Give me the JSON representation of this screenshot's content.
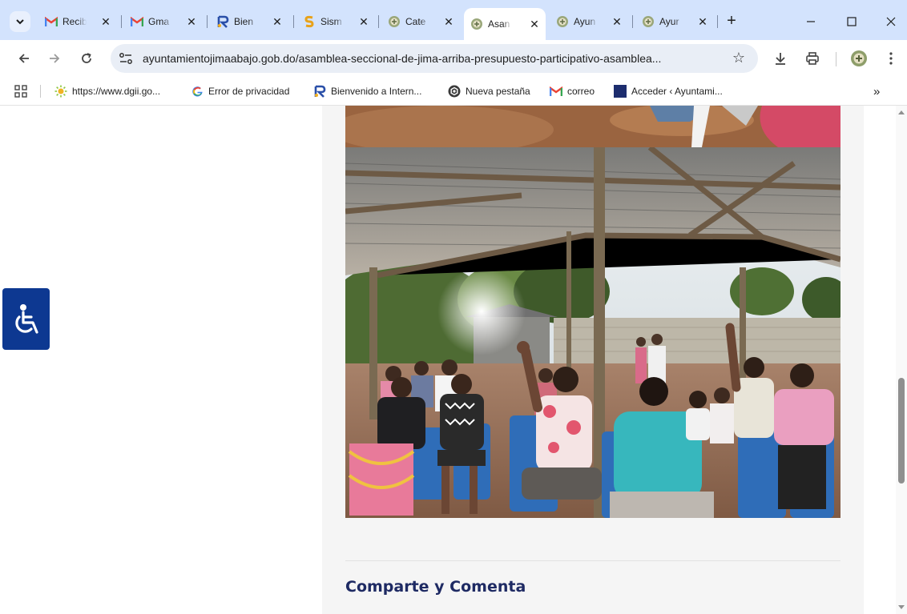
{
  "tabs": [
    {
      "title": "Recib",
      "favicon": "gmail-icon"
    },
    {
      "title": "Gma",
      "favicon": "gmail-icon"
    },
    {
      "title": "Bien",
      "favicon": "dgii-icon"
    },
    {
      "title": "Sism",
      "favicon": "sism-icon"
    },
    {
      "title": "Cate",
      "favicon": "ayuntamiento-seal-icon"
    },
    {
      "title": "Asan",
      "favicon": "ayuntamiento-seal-icon",
      "active": true
    },
    {
      "title": "Ayun",
      "favicon": "ayuntamiento-seal-icon"
    },
    {
      "title": "Ayur",
      "favicon": "ayuntamiento-seal-icon"
    }
  ],
  "address_bar": {
    "url": "ayuntamientojimaabajo.gob.do/asamblea-seccional-de-jima-arriba-presupuesto-participativo-asamblea..."
  },
  "bookmarks": [
    {
      "label": "https://www.dgii.go...",
      "icon": "dgii-sun-icon"
    },
    {
      "label": "Error de privacidad",
      "icon": "google-g-icon"
    },
    {
      "label": "Bienvenido a Intern...",
      "icon": "dgii-icon"
    },
    {
      "label": "Nueva pestaña",
      "icon": "openai-icon"
    },
    {
      "label": "correo",
      "icon": "gmail-icon"
    },
    {
      "label": "Acceder ‹ Ayuntami...",
      "icon": "square-blue-icon"
    }
  ],
  "article": {
    "share_heading": "Comparte y Comenta"
  },
  "colors": {
    "tabstrip_bg": "#d3e3fd",
    "omnibox_bg": "#e9eef6",
    "heading": "#1e2a63",
    "accessibility_button": "#0d3891",
    "content_panel": "#f5f5f5"
  }
}
